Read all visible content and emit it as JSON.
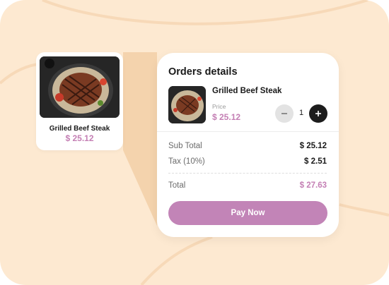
{
  "colors": {
    "background": "#fde9d1",
    "accent": "#c47fb4",
    "button": "#c284b7",
    "dark": "#1c1c1c"
  },
  "product_card": {
    "image_icon": "steak-image",
    "name": "Grilled Beef Steak",
    "price": "$ 25.12"
  },
  "order": {
    "title": "Orders details",
    "item": {
      "image_icon": "steak-image",
      "name": "Grilled Beef Steak",
      "price_label": "Price",
      "price": "$ 25.12",
      "quantity": "1",
      "minus_icon": "minus-icon",
      "plus_icon": "plus-icon"
    },
    "summary": {
      "subtotal_label": "Sub Total",
      "subtotal_value": "$ 25.12",
      "tax_label": "Tax (10%)",
      "tax_value": "$ 2.51",
      "total_label": "Total",
      "total_value": "$ 27.63"
    },
    "pay_button_label": "Pay Now"
  }
}
